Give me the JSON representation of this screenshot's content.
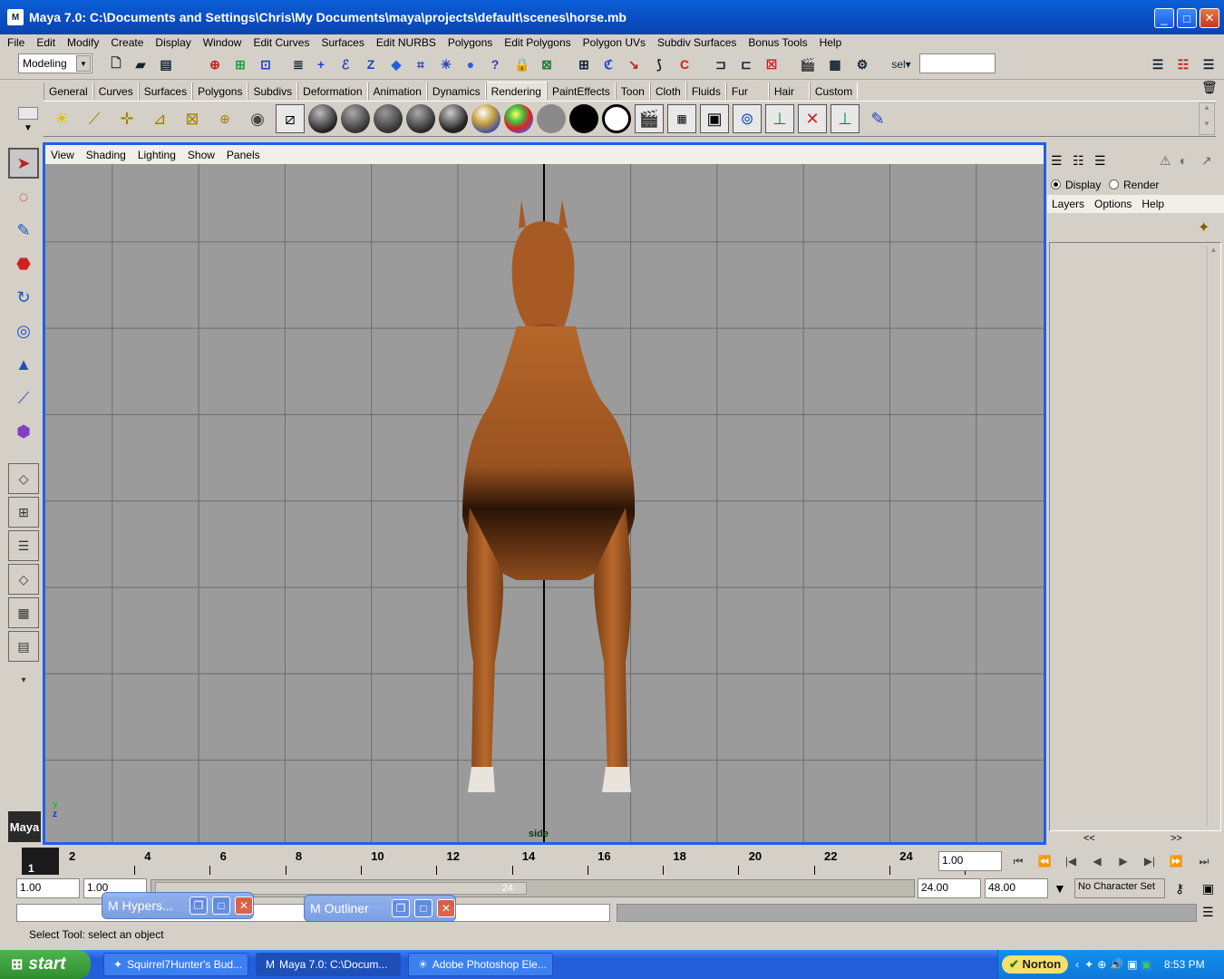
{
  "window": {
    "title": "Maya 7.0: C:\\Documents and Settings\\Chris\\My Documents\\maya\\projects\\default\\scenes\\horse.mb",
    "minimize": "_",
    "maximize": "□",
    "close": "✕"
  },
  "menubar": [
    "File",
    "Edit",
    "Modify",
    "Create",
    "Display",
    "Window",
    "Edit Curves",
    "Surfaces",
    "Edit NURBS",
    "Polygons",
    "Edit Polygons",
    "Polygon UVs",
    "Subdiv Surfaces",
    "Bonus Tools",
    "Help"
  ],
  "statusline": {
    "mode": "Modeling",
    "sel_label": "sel",
    "sel_value": ""
  },
  "shelf_tabs": [
    "General",
    "Curves",
    "Surfaces",
    "Polygons",
    "Subdivs",
    "Deformation",
    "Animation",
    "Dynamics",
    "Rendering",
    "PaintEffects",
    "Toon",
    "Cloth",
    "Fluids",
    "Fur",
    "Hair",
    "Custom"
  ],
  "active_shelf": "Rendering",
  "panel_menu": [
    "View",
    "Shading",
    "Lighting",
    "Show",
    "Panels"
  ],
  "viewport": {
    "camera": "side",
    "axis_y": "y",
    "axis_z": "z"
  },
  "channel_box": {
    "display_label": "Display",
    "render_label": "Render",
    "menu": [
      "Layers",
      "Options",
      "Help"
    ],
    "scroll_left": "<<",
    "scroll_right": ">>"
  },
  "timeline": {
    "current_frame": "1",
    "ticks": [
      "2",
      "4",
      "6",
      "8",
      "10",
      "12",
      "14",
      "16",
      "18",
      "20",
      "22",
      "24"
    ],
    "current_time": "1.00"
  },
  "range": {
    "start_time": "1.00",
    "start_range": "1.00",
    "end_range": "24.00",
    "end_time": "48.00",
    "range_end_label": "24",
    "character_set": "No Character Set"
  },
  "help_line": "Select Tool: select an object",
  "floating_windows": [
    {
      "title": "Hypers..."
    },
    {
      "title": "Outliner"
    }
  ],
  "taskbar": {
    "start": "start",
    "tasks": [
      "Squirrel7Hunter's Bud...",
      "Maya 7.0: C:\\Docum...",
      "Adobe Photoshop Ele..."
    ],
    "norton": "Norton",
    "clock": "8:53 PM"
  },
  "colors": {
    "title_blue": "#0b4dbf",
    "viewport_border": "#2060e8",
    "grid": "#9b9b9b",
    "horse": "#a85a24"
  },
  "logo": "Maya"
}
